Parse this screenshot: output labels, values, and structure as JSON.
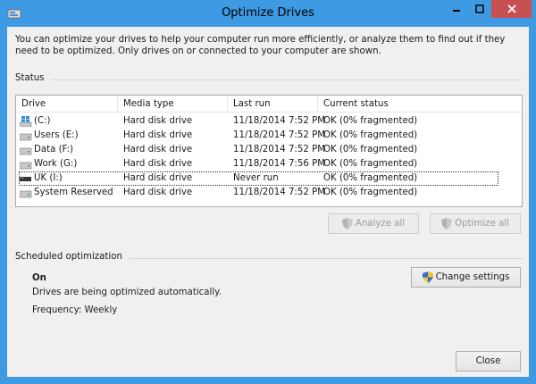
{
  "window": {
    "title": "Optimize Drives",
    "colors": {
      "frame": "#3e9ae2",
      "close": "#c75050",
      "background": "#f0f0f0"
    }
  },
  "intro_text": "You can optimize your drives to help your computer run more efficiently, or analyze them to find out if they need to be optimized. Only drives on or connected to your computer are shown.",
  "status": {
    "heading": "Status",
    "columns": [
      "Drive",
      "Media type",
      "Last run",
      "Current status"
    ],
    "rows": [
      {
        "drive": "(C:)",
        "icon": "windows-drive-icon",
        "media": "Hard disk drive",
        "last_run": "11/18/2014 7:52 PM",
        "status": "OK (0% fragmented)"
      },
      {
        "drive": "Users (E:)",
        "icon": "hard-drive-icon",
        "media": "Hard disk drive",
        "last_run": "11/18/2014 7:52 PM",
        "status": "OK (0% fragmented)"
      },
      {
        "drive": "Data (F:)",
        "icon": "hard-drive-icon",
        "media": "Hard disk drive",
        "last_run": "11/18/2014 7:52 PM",
        "status": "OK (0% fragmented)"
      },
      {
        "drive": "Work (G:)",
        "icon": "hard-drive-icon",
        "media": "Hard disk drive",
        "last_run": "11/18/2014 7:56 PM",
        "status": "OK (0% fragmented)"
      },
      {
        "drive": "UK (I:)",
        "icon": "removable-drive-icon",
        "media": "Hard disk drive",
        "last_run": "Never run",
        "status": "OK (0% fragmented)"
      },
      {
        "drive": "System Reserved",
        "icon": "hard-drive-icon",
        "media": "Hard disk drive",
        "last_run": "11/18/2014 7:52 PM",
        "status": "OK (0% fragmented)"
      }
    ],
    "selected_row": "UK (I:)"
  },
  "buttons": {
    "analyze_all": "Analyze all",
    "optimize_all": "Optimize all",
    "change_settings": "Change settings",
    "close": "Close"
  },
  "scheduled": {
    "heading": "Scheduled optimization",
    "state": "On",
    "description": "Drives are being optimized automatically.",
    "frequency": "Frequency: Weekly"
  }
}
